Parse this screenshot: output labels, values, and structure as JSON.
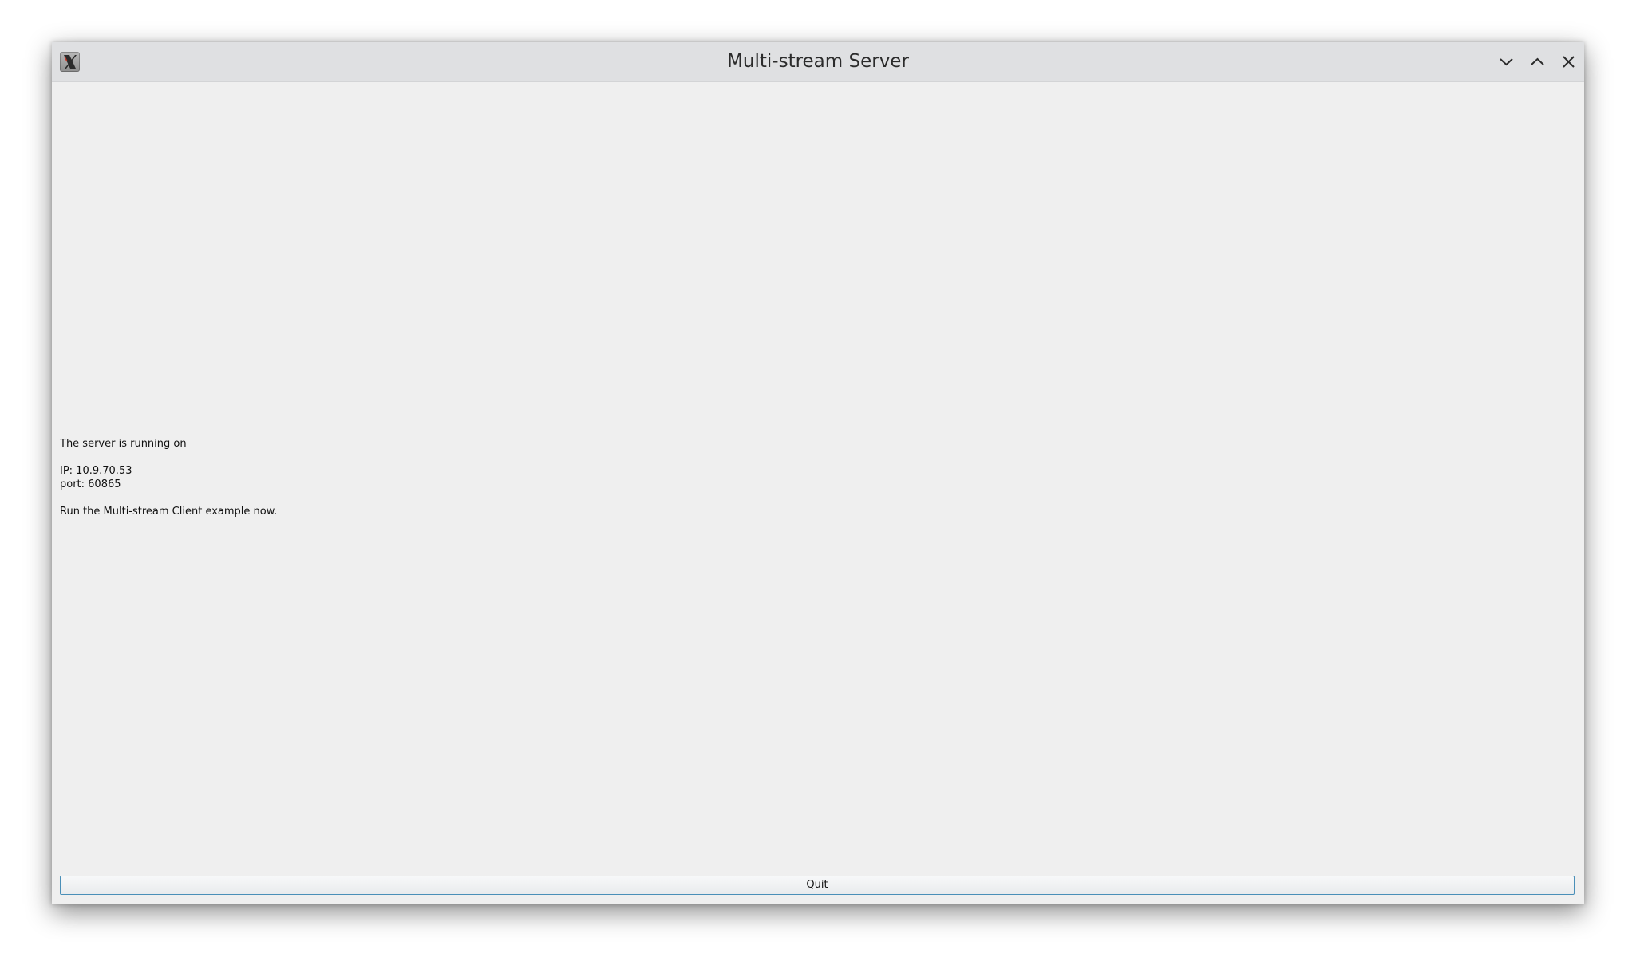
{
  "window": {
    "title": "Multi-stream Server",
    "icon": "x11-app-icon",
    "controls": {
      "minimize_icon": "chevron-down-icon",
      "maximize_icon": "chevron-up-icon",
      "close_icon": "close-icon"
    }
  },
  "main": {
    "status_line": "The server is running on",
    "ip_line": "IP: 10.9.70.53",
    "port_line": "port: 60865",
    "instruction_line": "Run the Multi-stream Client example now."
  },
  "footer": {
    "quit_label": "Quit"
  },
  "colors": {
    "titlebar": "#dfe0e2",
    "background": "#efefef",
    "button_border": "#4a8fb8"
  }
}
